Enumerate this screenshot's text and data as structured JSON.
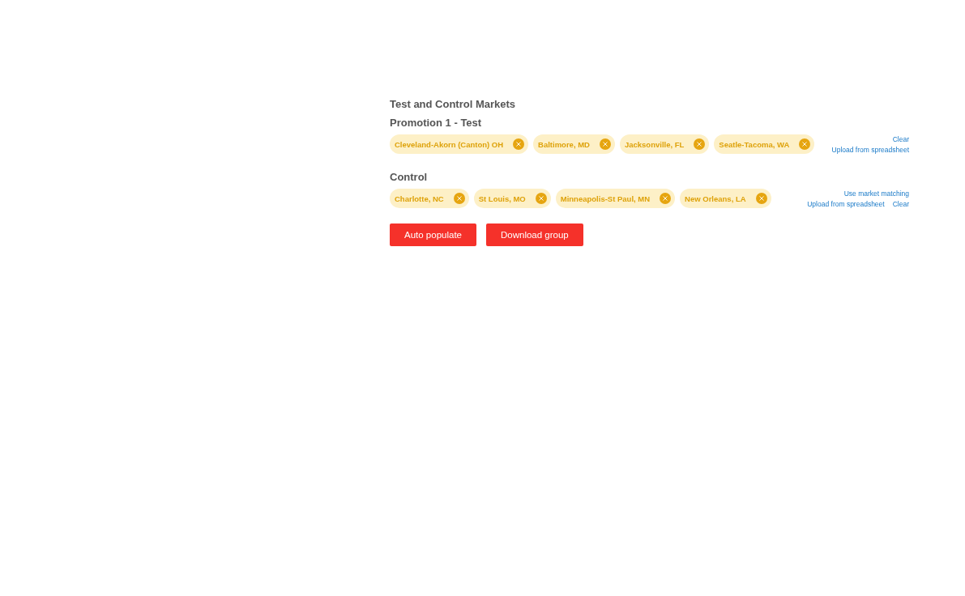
{
  "title": "Test and Control Markets",
  "groups": [
    {
      "title": "Promotion 1 - Test",
      "chips": [
        "Cleveland-Akorn (Canton) OH",
        "Baltimore, MD",
        "Jacksonville, FL",
        "Seatle-Tacoma, WA"
      ],
      "action_rows": [
        [
          "Clear"
        ],
        [
          "Upload from spreadsheet"
        ]
      ]
    },
    {
      "title": "Control",
      "chips": [
        "Charlotte, NC",
        "St Louis, MO",
        "Minneapolis-St Paul, MN",
        "New Orleans, LA"
      ],
      "action_rows": [
        [
          "Use market matching"
        ],
        [
          "Upload from spreadsheet",
          "Clear"
        ]
      ]
    }
  ],
  "buttons": [
    "Auto populate",
    "Download group"
  ]
}
